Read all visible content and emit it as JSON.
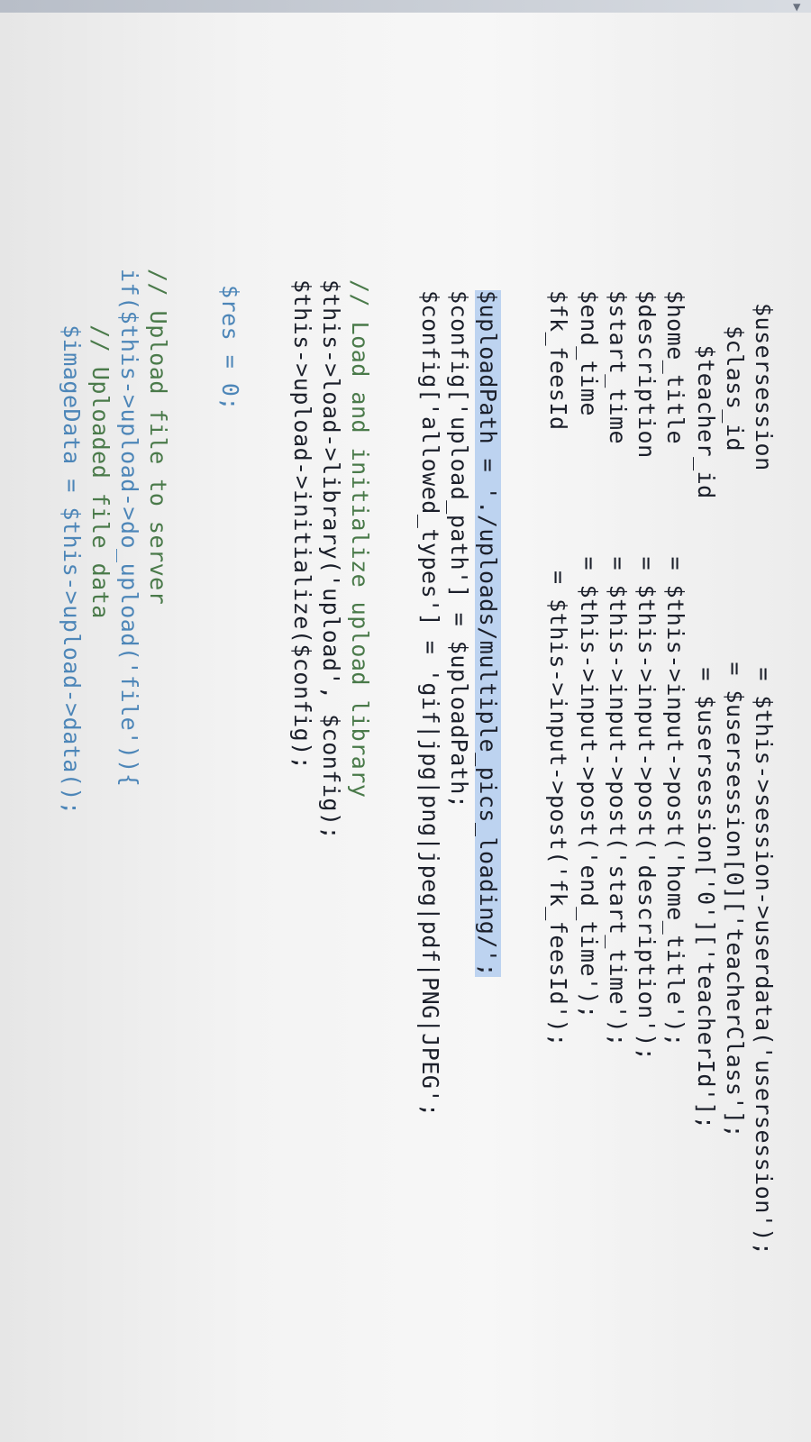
{
  "code": {
    "lines": [
      "$usersession              = $this->session->userdata('usersession');",
      "  $class_id               = $usersession[0]['teacherClass'];",
      "   $teacher_id            = $usersession['0']['teacherId'];",
      "$home_title        = $this->input->post('home_title');",
      "$description       = $this->input->post('description');",
      "$start_time        = $this->input->post('start_time');",
      "$end_time          = $this->input->post('end_time');",
      "$fk_feesId          = $this->input->post('fk_feesId');",
      "$uploadPath = './uploads/multiple_pics_loading/';",
      "$config['upload_path'] = $uploadPath;",
      "$config['allowed_types'] = 'gif|jpg|png|jpeg|pdf|PNG|JPEG';",
      "// Load and initialize upload library",
      "$this->load->library('upload', $config);",
      "$this->upload->initialize($config);",
      "$res = 0;",
      "// Upload file to server",
      "if($this->upload->do_upload('file')){",
      "    // Uploaded file data",
      "    $imageData = $this->upload->data();"
    ]
  }
}
